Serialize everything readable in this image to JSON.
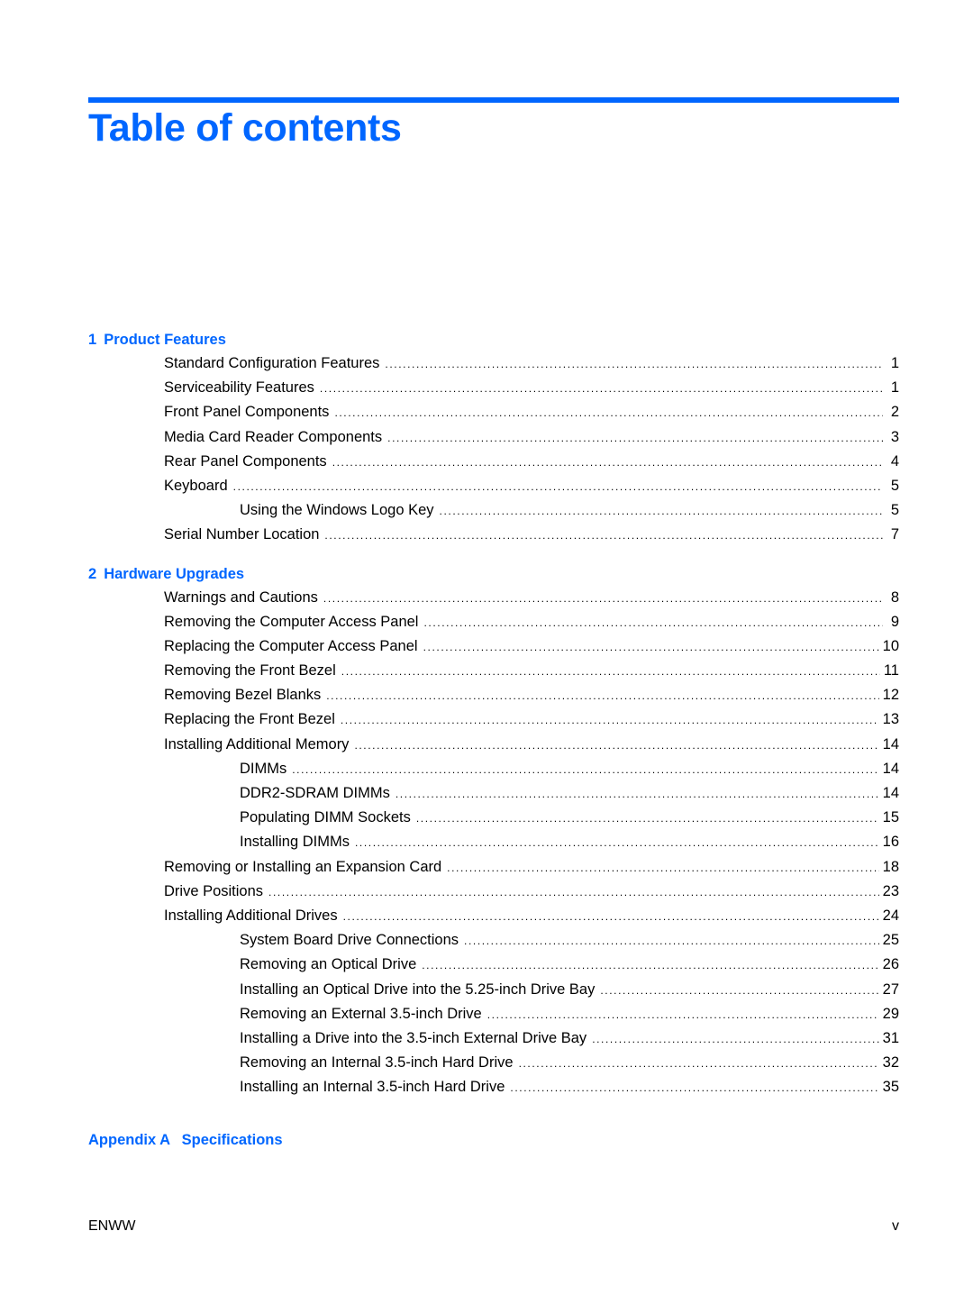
{
  "page": {
    "title": "Table of contents",
    "accent_color": "#0066ff"
  },
  "toc": {
    "chapters": [
      {
        "number": "1",
        "title": "Product Features",
        "entries": [
          {
            "label": "Standard Configuration Features",
            "page": "1",
            "level": 1
          },
          {
            "label": "Serviceability Features",
            "page": "1",
            "level": 1
          },
          {
            "label": "Front Panel Components",
            "page": "2",
            "level": 1
          },
          {
            "label": "Media Card Reader Components",
            "page": "3",
            "level": 1
          },
          {
            "label": "Rear Panel Components",
            "page": "4",
            "level": 1
          },
          {
            "label": "Keyboard",
            "page": "5",
            "level": 1
          },
          {
            "label": "Using the Windows Logo Key",
            "page": "5",
            "level": 2
          },
          {
            "label": "Serial Number Location",
            "page": "7",
            "level": 1
          }
        ]
      },
      {
        "number": "2",
        "title": "Hardware Upgrades",
        "entries": [
          {
            "label": "Warnings and Cautions",
            "page": "8",
            "level": 1
          },
          {
            "label": "Removing the Computer Access Panel",
            "page": "9",
            "level": 1
          },
          {
            "label": "Replacing the Computer Access Panel",
            "page": "10",
            "level": 1
          },
          {
            "label": "Removing the Front Bezel",
            "page": "11",
            "level": 1
          },
          {
            "label": "Removing Bezel Blanks",
            "page": "12",
            "level": 1
          },
          {
            "label": "Replacing the Front Bezel",
            "page": "13",
            "level": 1
          },
          {
            "label": "Installing Additional Memory",
            "page": "14",
            "level": 1
          },
          {
            "label": "DIMMs",
            "page": "14",
            "level": 2
          },
          {
            "label": "DDR2-SDRAM DIMMs",
            "page": "14",
            "level": 2
          },
          {
            "label": "Populating DIMM Sockets",
            "page": "15",
            "level": 2
          },
          {
            "label": "Installing DIMMs",
            "page": "16",
            "level": 2
          },
          {
            "label": "Removing or Installing an Expansion Card",
            "page": "18",
            "level": 1
          },
          {
            "label": "Drive Positions",
            "page": "23",
            "level": 1
          },
          {
            "label": "Installing Additional Drives",
            "page": "24",
            "level": 1
          },
          {
            "label": "System Board Drive Connections",
            "page": "25",
            "level": 2
          },
          {
            "label": "Removing an Optical Drive",
            "page": "26",
            "level": 2
          },
          {
            "label": "Installing an Optical Drive into the 5.25-inch Drive Bay",
            "page": "27",
            "level": 2
          },
          {
            "label": "Removing an External 3.5-inch Drive",
            "page": "29",
            "level": 2
          },
          {
            "label": "Installing a Drive into the 3.5-inch External Drive Bay",
            "page": "31",
            "level": 2
          },
          {
            "label": "Removing an Internal 3.5-inch Hard Drive",
            "page": "32",
            "level": 2
          },
          {
            "label": "Installing an Internal 3.5-inch Hard Drive",
            "page": "35",
            "level": 2
          }
        ]
      }
    ],
    "appendix": {
      "number": "Appendix A",
      "title": "Specifications"
    }
  },
  "footer": {
    "left": "ENWW",
    "right": "v"
  }
}
